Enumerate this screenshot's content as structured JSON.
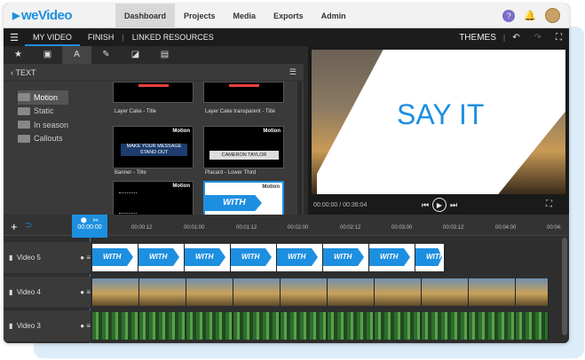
{
  "brand": "weVideo",
  "nav": {
    "items": [
      "Dashboard",
      "Projects",
      "Media",
      "Exports",
      "Admin"
    ],
    "active": 0,
    "help": "?"
  },
  "bar2": {
    "tabs": [
      "MY VIDEO",
      "FINISH",
      "LINKED RESOURCES"
    ],
    "themes": "THEMES"
  },
  "left": {
    "section": "TEXT",
    "folders": [
      "Motion",
      "Static",
      "In season",
      "Callouts"
    ],
    "thumbs": [
      {
        "caption": "Layer Cake - Title",
        "motion": ""
      },
      {
        "caption": "Layer Cake transparent - Title",
        "motion": ""
      },
      {
        "caption": "Banner - Title",
        "motion": "Motion",
        "line1": "MAKE YOUR MESSAGE",
        "line2": "STAND OUT"
      },
      {
        "caption": "Placard - Lower Third",
        "motion": "Motion",
        "line1": "CAMERON TAYLOR",
        "line2": ""
      },
      {
        "caption": "",
        "motion": "Motion"
      },
      {
        "caption": "",
        "motion": "Motion",
        "line1": "WITH"
      }
    ]
  },
  "preview": {
    "headline": "SAY IT",
    "time": "00:00:00 / 00:36:04"
  },
  "timeline": {
    "playhead": "00:00:00",
    "ticks": [
      "00:00:12",
      "00:01:00",
      "00:01:12",
      "00:02:00",
      "00:02:12",
      "00:03:00",
      "00:03:12",
      "00:04:00",
      "00:04:"
    ],
    "tracks": [
      {
        "name": "Video 5",
        "clip_text": "WITH"
      },
      {
        "name": "Video 4",
        "clip_text": ""
      },
      {
        "name": "Video 3",
        "clip_text": ""
      }
    ]
  },
  "colors": {
    "accent": "#1d8fe0",
    "nav_bg": "#f2f2f2",
    "panel_bg": "#3a3a3a"
  }
}
